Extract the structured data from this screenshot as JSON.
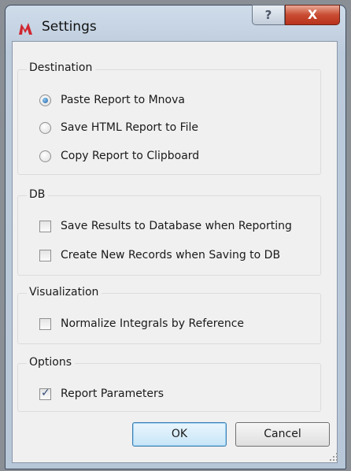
{
  "window": {
    "title": "Settings",
    "help_glyph": "?",
    "close_glyph": "X",
    "app_icon": "mnova-logo-icon"
  },
  "groups": {
    "destination": {
      "title": "Destination",
      "options": [
        {
          "label": "Paste Report to Mnova",
          "checked": true
        },
        {
          "label": "Save HTML Report to File",
          "checked": false
        },
        {
          "label": "Copy Report to Clipboard",
          "checked": false
        }
      ]
    },
    "db": {
      "title": "DB",
      "options": [
        {
          "label": "Save Results to Database when Reporting",
          "checked": false
        },
        {
          "label": "Create New Records when Saving to DB",
          "checked": false
        }
      ]
    },
    "visualization": {
      "title": "Visualization",
      "options": [
        {
          "label": "Normalize Integrals by Reference",
          "checked": false
        }
      ]
    },
    "options": {
      "title": "Options",
      "options": [
        {
          "label": "Report Parameters",
          "checked": true,
          "mark": "✓"
        }
      ]
    }
  },
  "buttons": {
    "ok": "OK",
    "cancel": "Cancel"
  }
}
